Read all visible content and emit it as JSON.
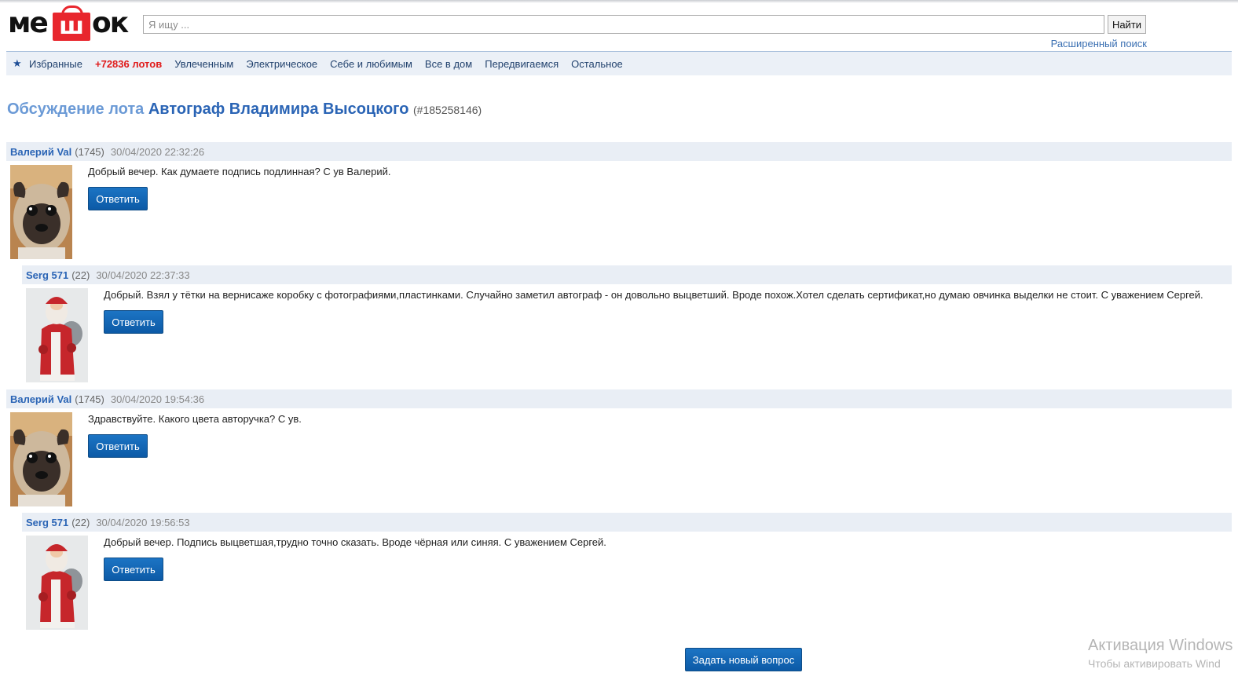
{
  "header": {
    "logo_text": "МЕШОК",
    "logo_parts": [
      "ме",
      "ш",
      "ок"
    ],
    "search_placeholder": "Я ищу ...",
    "search_button": "Найти",
    "advanced_search": "Расширенный поиск"
  },
  "nav": {
    "items": [
      "Избранные",
      "+72836 лотов",
      "Увлеченным",
      "Электрическое",
      "Себе и любимым",
      "Все в дом",
      "Передвигаемся",
      "Остальное"
    ]
  },
  "page": {
    "title_prefix": "Обсуждение лота",
    "title_name": "Автограф Владимира Высоцкого",
    "lot_id": "(#185258146)"
  },
  "comments": [
    {
      "user": "Валерий Val",
      "rating": "(1745)",
      "date": "30/04/2020 22:32:26",
      "text": "Добрый вечер. Как думаете подпись подлинная? С ув Валерий.",
      "reply": "Ответить",
      "avatar": "pug-avatar"
    },
    {
      "user": "Serg 571",
      "rating": "(22)",
      "date": "30/04/2020 22:37:33",
      "text": "Добрый. Взял у тётки на вернисаже коробку с фотографиями,пластинками. Случайно заметил автограф - он довольно выцветший. Вроде похож.Хотел сделать сертификат,но думаю овчинка выделки не стоит. С уважением Сергей.",
      "reply": "Ответить",
      "avatar": "santa-avatar"
    },
    {
      "user": "Валерий Val",
      "rating": "(1745)",
      "date": "30/04/2020 19:54:36",
      "text": "Здравствуйте. Какого цвета авторучка? С ув.",
      "reply": "Ответить",
      "avatar": "pug-avatar"
    },
    {
      "user": "Serg 571",
      "rating": "(22)",
      "date": "30/04/2020 19:56:53",
      "text": "Добрый вечер. Подпись выцветшая,трудно точно сказать. Вроде чёрная или синяя. С уважением Сергей.",
      "reply": "Ответить",
      "avatar": "santa-avatar"
    }
  ],
  "ask_button": "Задать новый вопрос",
  "watermark": {
    "line1": "Активация Windows",
    "line2": "Чтобы активировать Wind"
  },
  "colors": {
    "accent": "#2a64b5",
    "nav_bg": "#ebf0f7",
    "button": "#0c5aa6",
    "red": "#e01b1b"
  }
}
